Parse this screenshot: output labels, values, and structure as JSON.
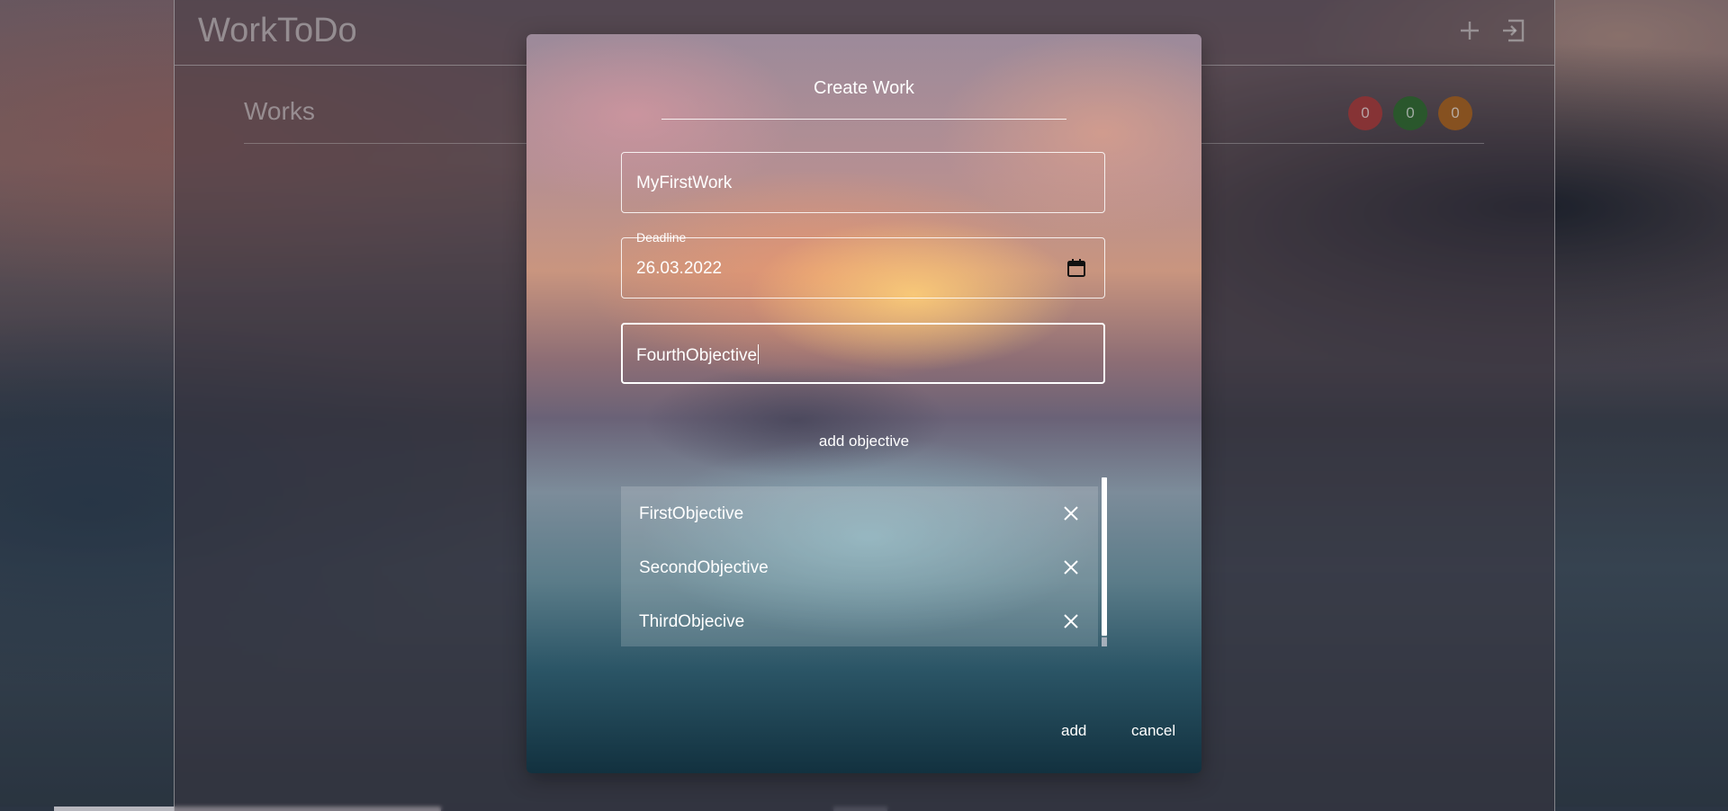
{
  "app": {
    "title": "WorkToDo",
    "header_icons": [
      "plus-icon",
      "logout-icon"
    ],
    "section_title": "Works",
    "badges": [
      {
        "value": "0",
        "color": "#a83a3a"
      },
      {
        "value": "0",
        "color": "#2e6a2e"
      },
      {
        "value": "0",
        "color": "#a8621e"
      }
    ]
  },
  "dialog": {
    "title": "Create Work",
    "name_value": "MyFirstWork",
    "deadline_label": "Deadline",
    "deadline_value": "26.03.2022",
    "objective_input_value": "FourthObjective",
    "add_objective_label": "add objective",
    "objectives": [
      {
        "label": "FirstObjective"
      },
      {
        "label": "SecondObjective"
      },
      {
        "label": "ThirdObjecive"
      }
    ],
    "add_label": "add",
    "cancel_label": "cancel"
  }
}
